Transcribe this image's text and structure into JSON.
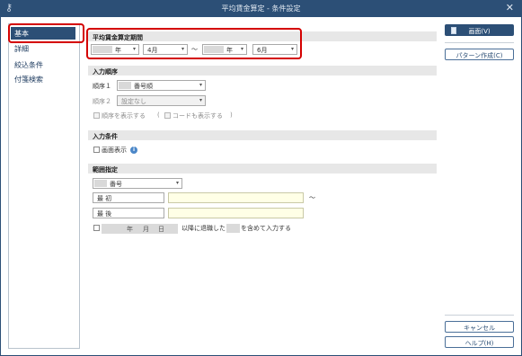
{
  "window": {
    "title": "平均賃金算定 - 条件設定",
    "close_glyph": "✕",
    "key_glyph": "⚷"
  },
  "sidebar": {
    "items": [
      {
        "label": "基本",
        "active": true
      },
      {
        "label": "詳細"
      },
      {
        "label": "絞込条件"
      },
      {
        "label": "付箋検索"
      }
    ]
  },
  "period": {
    "heading": "平均賃金算定期間",
    "start_year_suffix": "年",
    "start_month": "4月",
    "tilde": "～",
    "end_year_suffix": "年",
    "end_month": "6月"
  },
  "order": {
    "heading": "入力順序",
    "order1_label": "順序１",
    "order1_value": "番号順",
    "order2_label": "順序２",
    "order2_value": "設定なし",
    "show_order_label": "順序を表示する",
    "paren_open": "(",
    "show_code_label": "コードも表示する",
    "paren_close": ")"
  },
  "input_condition": {
    "heading": "入力条件",
    "screen_display_label": "画面表示",
    "info_glyph": "i"
  },
  "range": {
    "heading": "範囲指定",
    "type_value": "番号",
    "first_label": "最 初",
    "last_label": "最 後",
    "tilde": "～",
    "year_label": "年",
    "month_label": "月",
    "day_label": "日",
    "retired_text_1": "以降に退職した",
    "retired_text_2": "を含めて入力する"
  },
  "actions": {
    "screen_button": "画面(V)",
    "pattern_button": "パターン作成(C)",
    "cancel_button": "キャンセル",
    "help_button": "ヘルプ(H)"
  },
  "colors": {
    "accent": "#2c4f76",
    "highlight_red": "#d40000",
    "yellow_field": "#ffffe6"
  }
}
